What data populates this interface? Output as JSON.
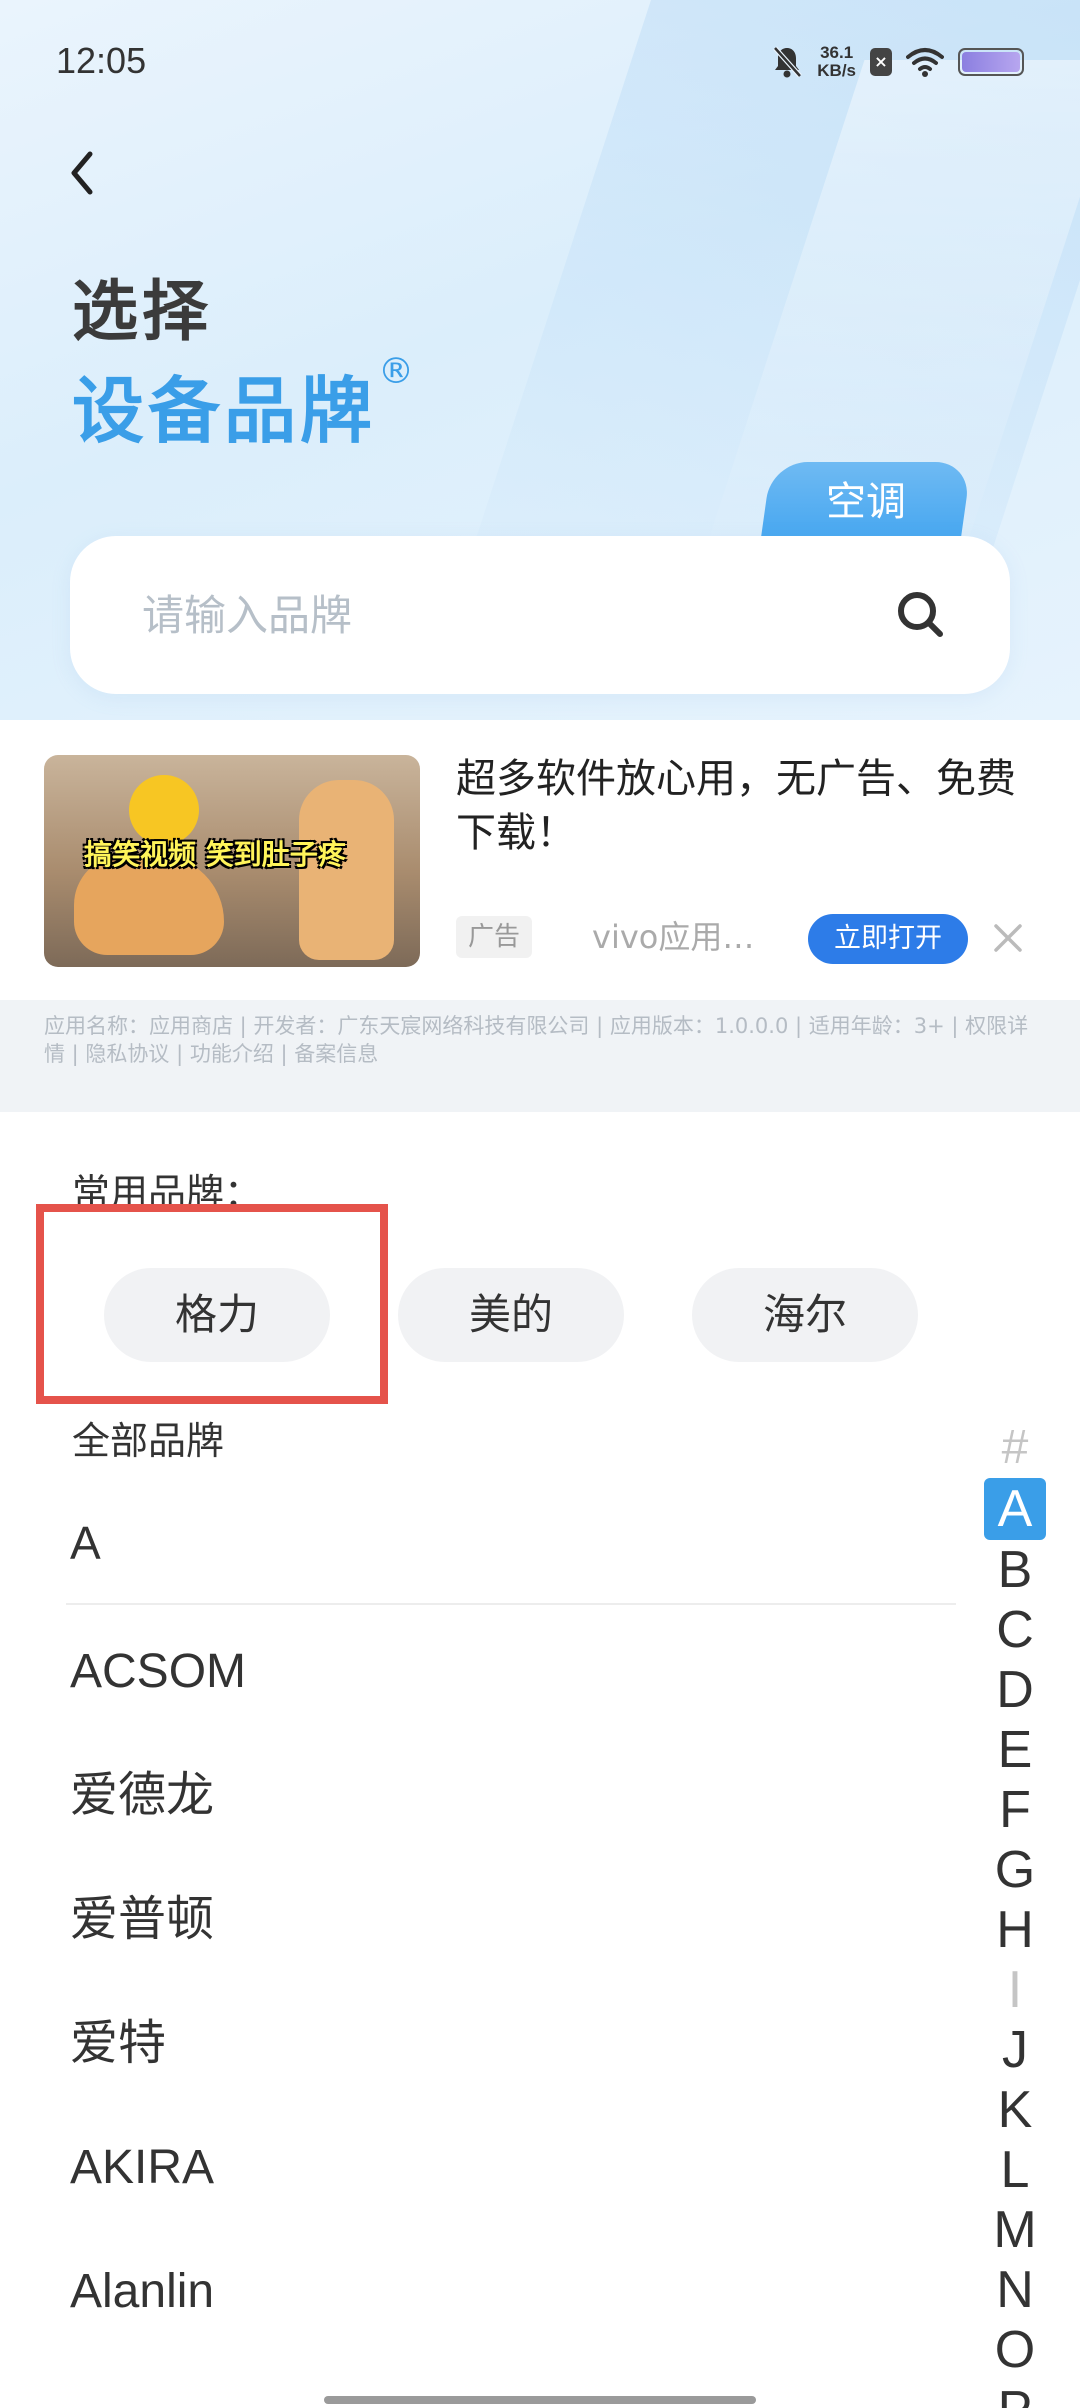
{
  "status_bar": {
    "time": "12:05",
    "net_speed_value": "36.1",
    "net_speed_unit": "KB/s",
    "sim_label": "×"
  },
  "header": {
    "title_line1": "选择",
    "title_line2": "设备品牌",
    "registered_mark": "®",
    "category_tab": "空调"
  },
  "search": {
    "placeholder": "请输入品牌",
    "value": ""
  },
  "ad": {
    "image_text": "搞笑视频 笑到肚子疼",
    "headline": "超多软件放心用，无广告、免费下载！",
    "tag": "广告",
    "source": "vivo应用…",
    "open_button": "立即打开",
    "info_line": "应用名称：应用商店 | 开发者：广东天宸网络科技有限公司 | 应用版本：1.0.0.0 | 适用年龄：3+ | 权限详情 | 隐私协议 | 功能介绍 | 备案信息"
  },
  "common_brands": {
    "label": "常用品牌：",
    "items": [
      "格力",
      "美的",
      "海尔"
    ]
  },
  "all_brands": {
    "label": "全部品牌",
    "section_letter": "A",
    "items": [
      "ACSOM",
      "爱德龙",
      "爱普顿",
      "爱特",
      "AKIRA",
      "Alanlin"
    ]
  },
  "index_bar": [
    "#",
    "A",
    "B",
    "C",
    "D",
    "E",
    "F",
    "G",
    "H",
    "I",
    "J",
    "K",
    "L",
    "M",
    "N",
    "O",
    "P"
  ],
  "index_active": "A",
  "colors": {
    "accent": "#3a9ee8",
    "highlight": "#e5534b",
    "ad_button": "#2d7ce8"
  }
}
